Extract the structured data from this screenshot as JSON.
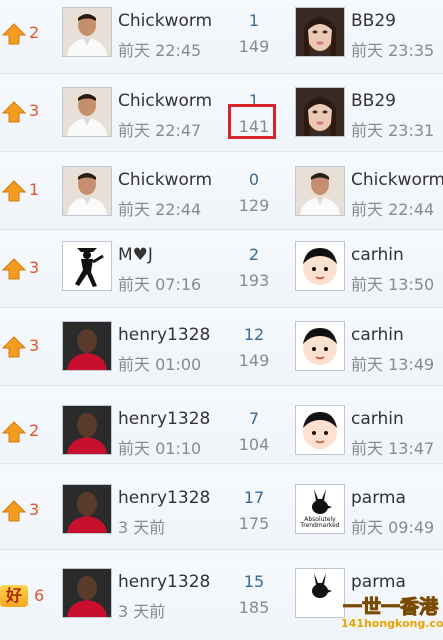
{
  "rows": [
    {
      "rank_icon": "up-arrow-icon",
      "rank": "2",
      "author": "Chickworm",
      "author_avatar": "soccer-player-avatar",
      "post_time": "前天 22:45",
      "replies": "1",
      "views": "149",
      "last_user": "BB29",
      "last_avatar": "woman-portrait-avatar",
      "last_time": "前天 23:35"
    },
    {
      "rank_icon": "up-arrow-icon",
      "rank": "3",
      "author": "Chickworm",
      "author_avatar": "soccer-player-avatar",
      "post_time": "前天 22:47",
      "replies": "1",
      "views": "141",
      "last_user": "BB29",
      "last_avatar": "woman-portrait-avatar",
      "last_time": "前天 23:31"
    },
    {
      "rank_icon": "up-arrow-icon",
      "rank": "1",
      "author": "Chickworm",
      "author_avatar": "soccer-player-avatar",
      "post_time": "前天 22:44",
      "replies": "0",
      "views": "129",
      "last_user": "Chickworm",
      "last_avatar": "soccer-player-avatar",
      "last_time": "前天 22:44"
    },
    {
      "rank_icon": "up-arrow-icon",
      "rank": "3",
      "author": "M♥J",
      "author_avatar": "dancer-silhouette-avatar",
      "post_time": "前天 07:16",
      "replies": "2",
      "views": "193",
      "last_user": "carhin",
      "last_avatar": "cartoon-boy-avatar",
      "last_time": "前天 13:50"
    },
    {
      "rank_icon": "up-arrow-icon",
      "rank": "3",
      "author": "henry1328",
      "author_avatar": "soccer-player-red-avatar",
      "post_time": "前天 01:00",
      "replies": "12",
      "views": "149",
      "last_user": "carhin",
      "last_avatar": "cartoon-boy-avatar",
      "last_time": "前天 13:49"
    },
    {
      "rank_icon": "up-arrow-icon",
      "rank": "2",
      "author": "henry1328",
      "author_avatar": "soccer-player-red-avatar",
      "post_time": "前天 01:10",
      "replies": "7",
      "views": "104",
      "last_user": "carhin",
      "last_avatar": "cartoon-boy-avatar",
      "last_time": "前天 13:47"
    },
    {
      "rank_icon": "up-arrow-icon",
      "rank": "3",
      "author": "henry1328",
      "author_avatar": "soccer-player-red-avatar",
      "post_time": "3 天前",
      "replies": "17",
      "views": "175",
      "last_user": "parma",
      "last_avatar": "playboy-bunny-logo-avatar",
      "last_time": "前天 09:49"
    },
    {
      "rank_icon": "good-badge-icon",
      "rank": "6",
      "author": "henry1328",
      "author_avatar": "soccer-player-red-avatar",
      "post_time": "3 天前",
      "replies": "15",
      "views": "185",
      "last_user": "parma",
      "last_avatar": "playboy-bunny-logo-avatar",
      "last_time": ""
    }
  ],
  "badge_text": "好",
  "bunny_caption": "Absolutely Trendmarked",
  "watermark": {
    "line1": "一世一香港",
    "line2": "141hongkong.com",
    "color": "#e8a400"
  }
}
